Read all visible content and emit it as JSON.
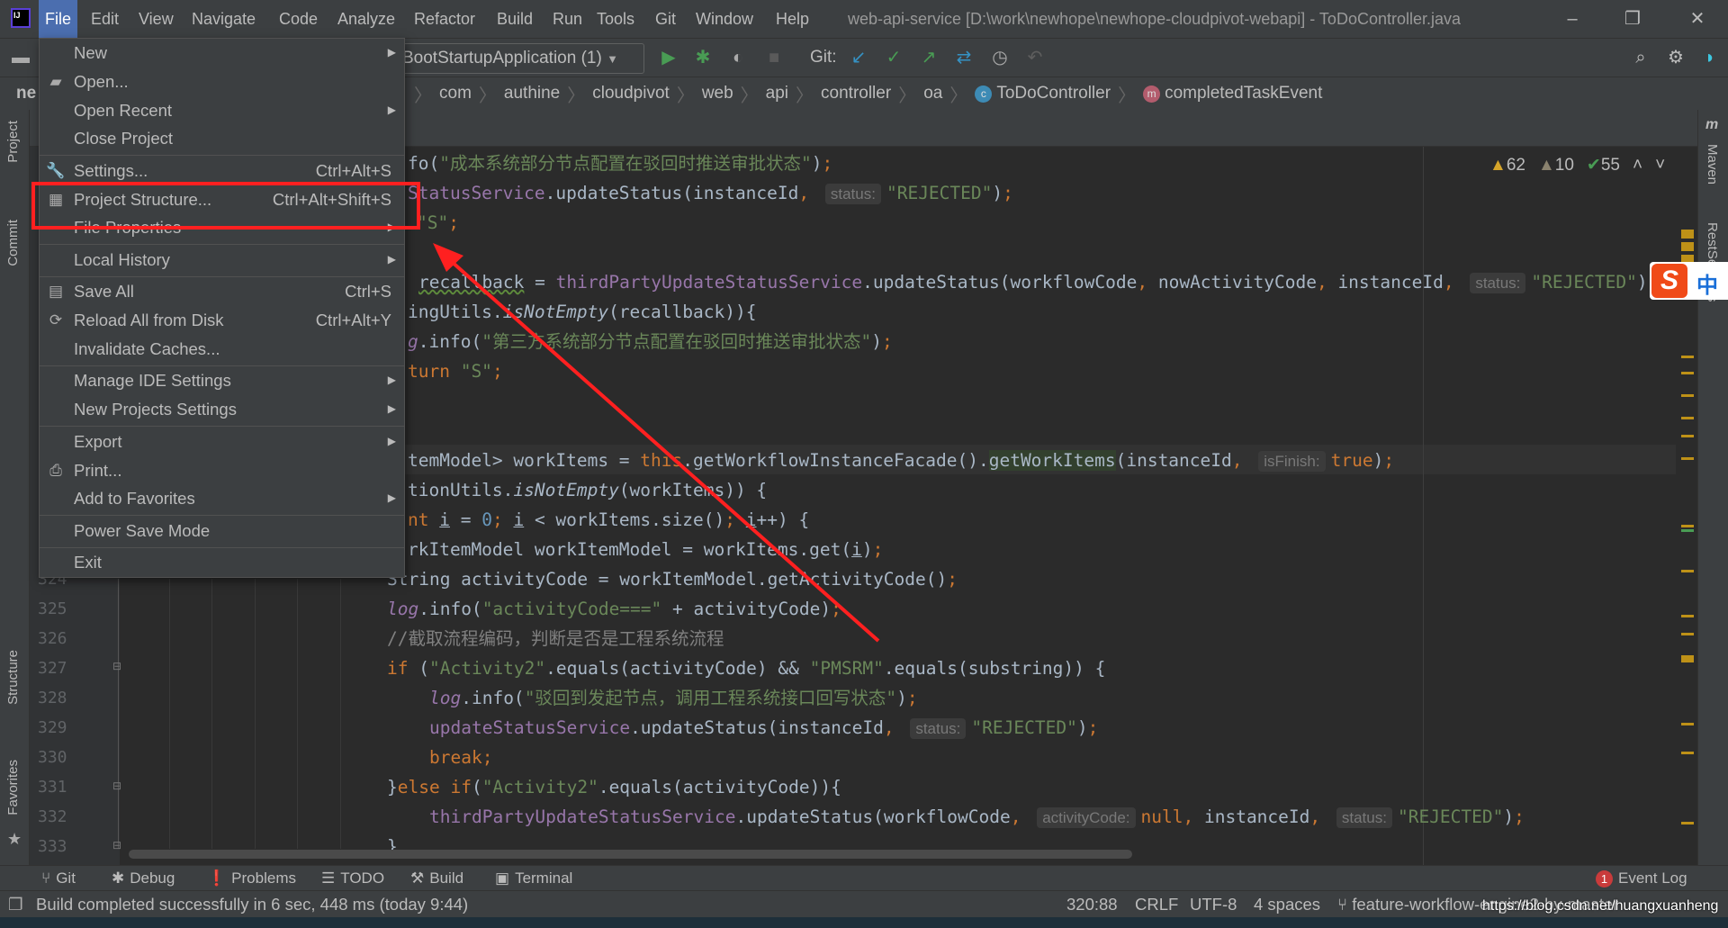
{
  "menubar": {
    "items": [
      "File",
      "Edit",
      "View",
      "Navigate",
      "Code",
      "Analyze",
      "Refactor",
      "Build",
      "Run",
      "Tools",
      "Git",
      "Window",
      "Help"
    ],
    "active": "File",
    "window_title": "web-api-service [D:\\work\\newhope\\newhope-cloudpivot-webapi] - ToDoController.java",
    "logo_text": "IJ"
  },
  "toolbar": {
    "run_config": "BootStartupApplication (1)",
    "git_label": "Git:",
    "icons": [
      "folder-icon",
      "run-icon",
      "debug-icon",
      "coverage-icon",
      "stop-icon",
      "git-update-icon",
      "git-commit-icon",
      "git-push-icon",
      "git-merge-icon",
      "history-icon",
      "rollback-icon",
      "search-icon",
      "gear-icon",
      "toolbox-icon"
    ]
  },
  "breadcrumb": {
    "project_stub": "ne",
    "items": [
      "com",
      "authine",
      "cloudpivot",
      "web",
      "api",
      "controller",
      "oa"
    ],
    "class_name": "ToDoController",
    "method_name": "completedTaskEvent"
  },
  "file_menu": {
    "items": [
      {
        "label": "New",
        "submenu": true
      },
      {
        "label": "Open...",
        "icon": "folder-open-icon"
      },
      {
        "label": "Open Recent",
        "submenu": true
      },
      {
        "label": "Close Project"
      },
      {
        "sep": true
      },
      {
        "label": "Settings...",
        "icon": "wrench-icon",
        "shortcut": "Ctrl+Alt+S"
      },
      {
        "label": "Project Structure...",
        "icon": "project-structure-icon",
        "shortcut": "Ctrl+Alt+Shift+S",
        "annotated": true
      },
      {
        "label": "File Properties",
        "submenu": true
      },
      {
        "sep": true
      },
      {
        "label": "Local History",
        "submenu": true
      },
      {
        "sep": true
      },
      {
        "label": "Save All",
        "icon": "save-icon",
        "shortcut": "Ctrl+S"
      },
      {
        "label": "Reload All from Disk",
        "icon": "reload-icon",
        "shortcut": "Ctrl+Alt+Y"
      },
      {
        "label": "Invalidate Caches..."
      },
      {
        "sep": true
      },
      {
        "label": "Manage IDE Settings",
        "submenu": true
      },
      {
        "label": "New Projects Settings",
        "submenu": true
      },
      {
        "sep": true
      },
      {
        "label": "Export",
        "submenu": true
      },
      {
        "label": "Print...",
        "icon": "print-icon"
      },
      {
        "label": "Add to Favorites",
        "submenu": true
      },
      {
        "sep": true
      },
      {
        "label": "Power Save Mode"
      },
      {
        "sep": true
      },
      {
        "label": "Exit"
      }
    ]
  },
  "inspections": {
    "warnings": "62",
    "weak_warnings": "10",
    "typos": "55"
  },
  "editor": {
    "first_visible_number": 324,
    "line_numbers": [
      "324",
      "325",
      "326",
      "327",
      "328",
      "329",
      "330",
      "331",
      "332",
      "333"
    ],
    "lines": [
      [
        [
          "fo(",
          "p"
        ],
        [
          "\"成本系统部分节点配置在驳回时推送审批状态\"",
          "s"
        ],
        [
          ")",
          "p"
        ],
        [
          ";",
          "k"
        ]
      ],
      [
        [
          "StatusService",
          "f"
        ],
        [
          ".updateStatus(instanceId",
          "p"
        ],
        [
          ", ",
          "k"
        ],
        [
          "status:",
          "h"
        ],
        [
          "\"REJECTED\"",
          "s"
        ],
        [
          ")",
          "p"
        ],
        [
          ";",
          "k"
        ]
      ],
      [
        [
          "\"S\"",
          "s"
        ],
        [
          ";",
          "k"
        ]
      ],
      [],
      [
        [
          "recallback",
          "pu"
        ],
        [
          " = ",
          "p"
        ],
        [
          "thirdPartyUpdateStatusService",
          "f"
        ],
        [
          ".updateStatus(workflowCode",
          "p"
        ],
        [
          ", ",
          "k"
        ],
        [
          "nowActivityCode",
          "p"
        ],
        [
          ", ",
          "k"
        ],
        [
          "instanceId",
          "p"
        ],
        [
          ", ",
          "k"
        ],
        [
          "status:",
          "h"
        ],
        [
          "\"REJECTED\"",
          "s"
        ],
        [
          ");",
          "p"
        ]
      ],
      [
        [
          "ingUtils.",
          "p"
        ],
        [
          "isNotEmpty",
          "i"
        ],
        [
          "(recallback)){",
          "p"
        ]
      ],
      [
        [
          "g",
          "fi"
        ],
        [
          ".info(",
          "p"
        ],
        [
          "\"第三方系统部分节点配置在驳回时推送审批状态\"",
          "s"
        ],
        [
          ")",
          "p"
        ],
        [
          ";",
          "k"
        ]
      ],
      [
        [
          "turn ",
          "k"
        ],
        [
          "\"S\"",
          "s"
        ],
        [
          ";",
          "k"
        ]
      ],
      [],
      [],
      [
        [
          "temModel> workItems = ",
          "p"
        ],
        [
          "this",
          "k"
        ],
        [
          ".getWorkflowInstanceFacade().",
          "p"
        ],
        [
          "getWorkItems",
          "m"
        ],
        [
          "(instanceId",
          "p"
        ],
        [
          ", ",
          "k"
        ],
        [
          "isFinish:",
          "h"
        ],
        [
          "true",
          "k"
        ],
        [
          ")",
          "p"
        ],
        [
          ";",
          "k"
        ]
      ],
      [
        [
          "tionUtils.",
          "p"
        ],
        [
          "isNotEmpty",
          "i"
        ],
        [
          "(workItems)) {",
          "p"
        ]
      ],
      [
        [
          "nt ",
          "k"
        ],
        [
          "i",
          "u"
        ],
        [
          " = ",
          "p"
        ],
        [
          "0",
          "n"
        ],
        [
          "; ",
          "k"
        ],
        [
          "i",
          "u"
        ],
        [
          " < workItems.size()",
          "p"
        ],
        [
          "; ",
          "k"
        ],
        [
          "i",
          "u"
        ],
        [
          "++) {",
          "p"
        ]
      ],
      [
        [
          "rkItemModel workItemModel = workItems.get(",
          "p"
        ],
        [
          "i",
          "u"
        ],
        [
          ")",
          "p"
        ],
        [
          ";",
          "k"
        ]
      ],
      [
        [
          "String activityCode = workItemModel.getActivityCode()",
          "p"
        ],
        [
          ";",
          "k"
        ]
      ],
      [
        [
          "log",
          "fi"
        ],
        [
          ".info(",
          "p"
        ],
        [
          "\"activityCode===\"",
          "s"
        ],
        [
          " + activityCode)",
          "p"
        ],
        [
          ";",
          "k"
        ]
      ],
      [
        [
          "//截取流程编码，判断是否是工程系统流程",
          "c"
        ]
      ],
      [
        [
          "if ",
          "k"
        ],
        [
          "(",
          "p"
        ],
        [
          "\"Activity2\"",
          "s"
        ],
        [
          ".equals(activityCode) && ",
          "p"
        ],
        [
          "\"PMSRM\"",
          "s"
        ],
        [
          ".equals(substring)) {",
          "p"
        ]
      ],
      [
        [
          "log",
          "fi"
        ],
        [
          ".info(",
          "p"
        ],
        [
          "\"驳回到发起节点，调用工程系统接口回写状态\"",
          "s"
        ],
        [
          ")",
          "p"
        ],
        [
          ";",
          "k"
        ]
      ],
      [
        [
          "updateStatusService",
          "f"
        ],
        [
          ".updateStatus(instanceId",
          "p"
        ],
        [
          ", ",
          "k"
        ],
        [
          "status:",
          "h"
        ],
        [
          "\"REJECTED\"",
          "s"
        ],
        [
          ")",
          "p"
        ],
        [
          ";",
          "k"
        ]
      ],
      [
        [
          "break",
          "k"
        ],
        [
          ";",
          "k"
        ]
      ],
      [
        [
          "}",
          "p"
        ],
        [
          "else if",
          "k"
        ],
        [
          "(",
          "p"
        ],
        [
          "\"Activity2\"",
          "s"
        ],
        [
          ".equals(activityCode)){",
          "p"
        ]
      ],
      [
        [
          "thirdPartyUpdateStatusService",
          "f"
        ],
        [
          ".updateStatus(workflowCode",
          "p"
        ],
        [
          ", ",
          "k"
        ],
        [
          "activityCode:",
          "h"
        ],
        [
          "null",
          "k"
        ],
        [
          ", ",
          "k"
        ],
        [
          "instanceId",
          "p"
        ],
        [
          ", ",
          "k"
        ],
        [
          "status:",
          "h"
        ],
        [
          "\"REJECTED\"",
          "s"
        ],
        [
          ")",
          "p"
        ],
        [
          ";",
          "k"
        ]
      ],
      [
        [
          "}",
          "p"
        ]
      ]
    ]
  },
  "side_panels": {
    "left": [
      "Project",
      "Commit",
      "Structure",
      "Favorites"
    ],
    "right": [
      "Maven",
      "RestServices"
    ]
  },
  "bottom_tools": [
    "Git",
    "Debug",
    "Problems",
    "TODO",
    "Build",
    "Terminal"
  ],
  "event_log": {
    "label": "Event Log",
    "count": "1"
  },
  "statusbar": {
    "message": "Build completed successfully in 6 sec, 448 ms (today 9:44)",
    "position": "320:88",
    "line_sep": "CRLF",
    "encoding": "UTF-8",
    "indent": "4 spaces",
    "branch": "feature-workflow-engine2-by-master",
    "watermark": "https://blog.csdn.net/huangxuanheng"
  },
  "ime": {
    "label": "中"
  },
  "colors": {
    "accent": "#4b6eaf",
    "annotation": "#ff2020",
    "keyword": "#cc7832",
    "string": "#6a8759",
    "field": "#9876aa"
  }
}
